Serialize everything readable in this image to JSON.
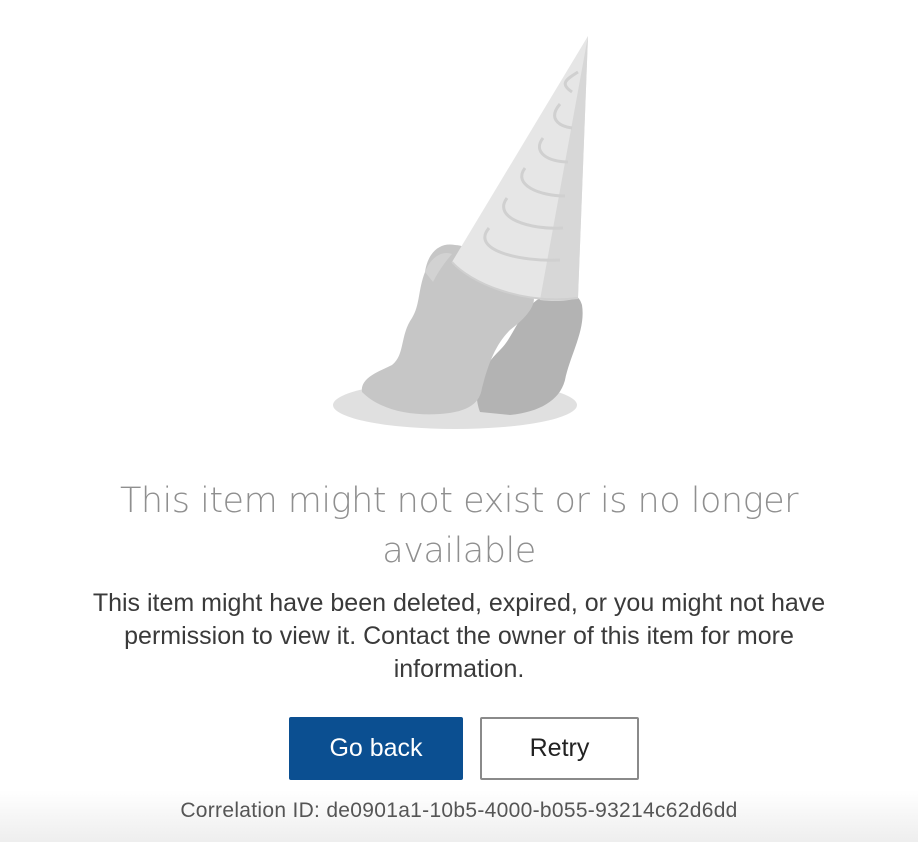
{
  "error": {
    "illustration_icon": "melted-ice-cream-cone-icon",
    "title": "This item might not exist or is no longer available",
    "description": "This item might have been deleted, expired, or you might not have permission to view it. Contact the owner of this item for more information."
  },
  "actions": {
    "go_back_label": "Go back",
    "retry_label": "Retry"
  },
  "footer": {
    "correlation_text": "Correlation ID: de0901a1-10b5-4000-b055-93214c62d6dd"
  },
  "colors": {
    "primary_button": "#0b4f91",
    "title_text": "#8f8f8f",
    "body_text": "#3a3a3a"
  }
}
